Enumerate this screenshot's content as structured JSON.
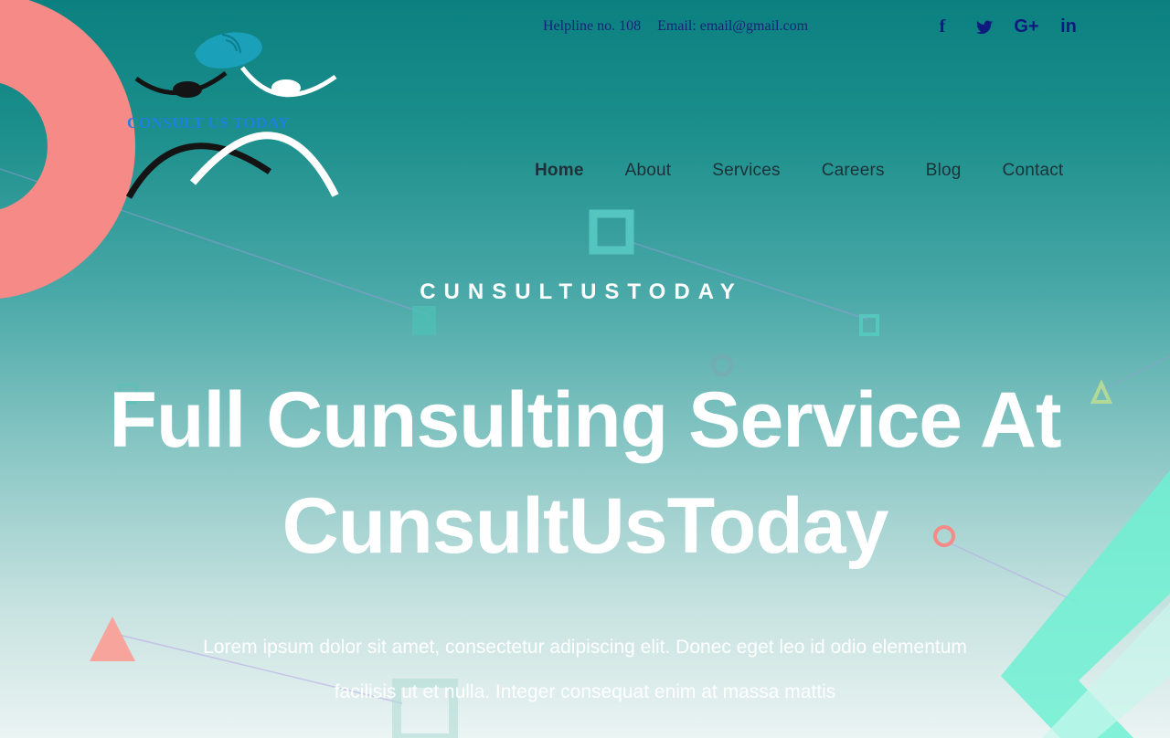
{
  "topbar": {
    "helpline": "Helpline no. 108",
    "email": "Email: email@gmail.com"
  },
  "social": [
    {
      "icon": "facebook-icon",
      "glyph": "f"
    },
    {
      "icon": "twitter-icon",
      "glyph": "🐦"
    },
    {
      "icon": "google-plus-icon",
      "glyph": "G+"
    },
    {
      "icon": "linkedin-icon",
      "glyph": "in"
    }
  ],
  "logo": {
    "text": "CONSULT US TODAY"
  },
  "nav": {
    "items": [
      "Home",
      "About",
      "Services",
      "Careers",
      "Blog",
      "Contact"
    ],
    "active": "Home"
  },
  "hero": {
    "kicker": "CUNSULTUSTODAY",
    "headline_line1": "Full Cunsulting Service At",
    "headline_line2": "CunsultUsToday",
    "body_line1": "Lorem ipsum dolor sit amet, consectetur adipiscing elit. Donec eget leo id odio elementum",
    "body_line2": "facilisis ut et nulla. Integer consequat enim at massa mattis"
  },
  "colors": {
    "accent_coral": "#f58a86",
    "accent_mint": "#6ff0d2",
    "nav_text": "#1d3238",
    "topbar_text": "#17227a"
  }
}
